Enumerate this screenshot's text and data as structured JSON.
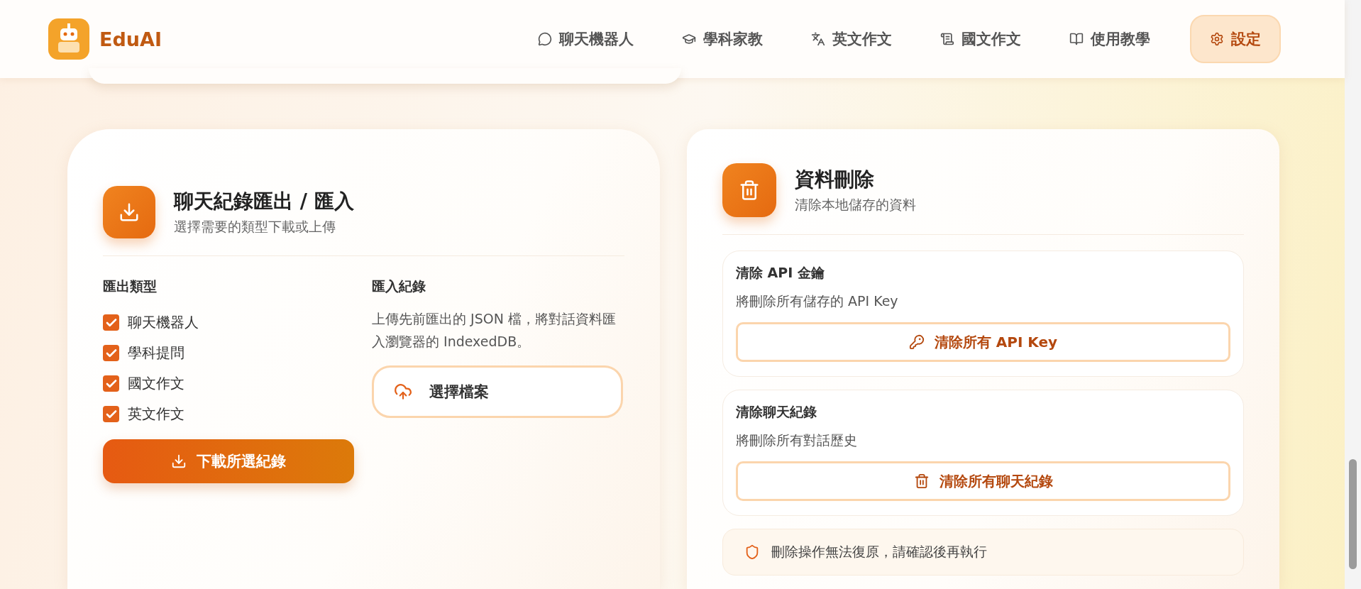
{
  "brand": {
    "name": "EduAI"
  },
  "nav": [
    {
      "label": "聊天機器人",
      "selected": false
    },
    {
      "label": "學科家教",
      "selected": false
    },
    {
      "label": "英文作文",
      "selected": false
    },
    {
      "label": "國文作文",
      "selected": false
    },
    {
      "label": "使用教學",
      "selected": false
    },
    {
      "label": "設定",
      "selected": true
    }
  ],
  "export_card": {
    "title": "聊天紀錄匯出 / 匯入",
    "subtitle": "選擇需要的類型下載或上傳",
    "export_heading": "匯出類型",
    "types": [
      {
        "label": "聊天機器人",
        "checked": true
      },
      {
        "label": "學科提問",
        "checked": true
      },
      {
        "label": "國文作文",
        "checked": true
      },
      {
        "label": "英文作文",
        "checked": true
      }
    ],
    "download_button": "下載所選紀錄",
    "import_heading": "匯入紀錄",
    "import_text": "上傳先前匯出的 JSON 檔，將對話資料匯入瀏覽器的 IndexedDB。",
    "choose_button": "選擇檔案"
  },
  "delete_card": {
    "title": "資料刪除",
    "subtitle": "清除本地儲存的資料",
    "sections": [
      {
        "title": "清除 API 金鑰",
        "text": "將刪除所有儲存的 API Key",
        "button": "清除所有 API Key"
      },
      {
        "title": "清除聊天紀錄",
        "text": "將刪除所有對話歷史",
        "button": "清除所有聊天紀錄"
      }
    ],
    "warning": "刪除操作無法復原，請確認後再執行"
  }
}
